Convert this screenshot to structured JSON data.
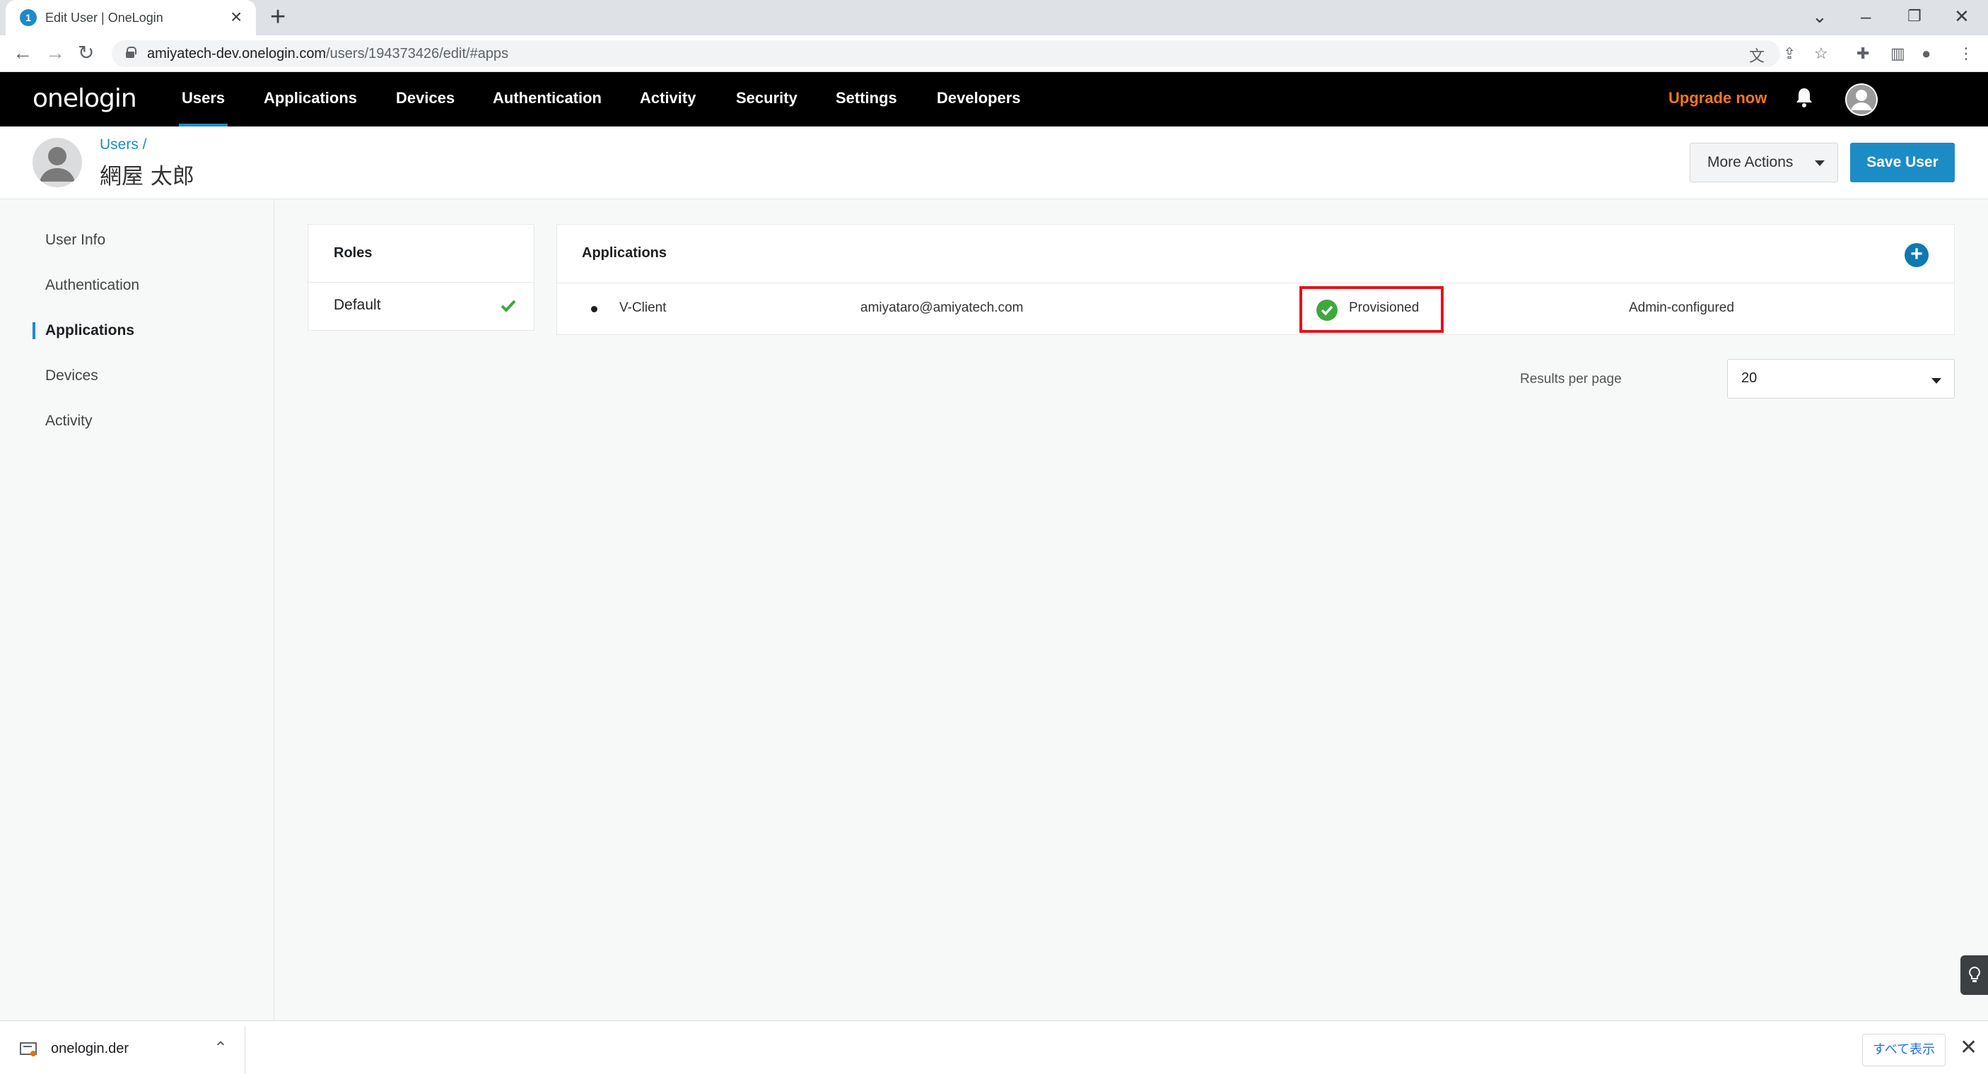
{
  "browser": {
    "tab_title": "Edit User | OneLogin",
    "favicon_glyph": "1",
    "url_host": "amiyatech-dev.onelogin.com",
    "url_path": "/users/194373426/edit/#apps"
  },
  "topnav": {
    "logo": "onelogin",
    "items": [
      "Users",
      "Applications",
      "Devices",
      "Authentication",
      "Activity",
      "Security",
      "Settings",
      "Developers"
    ],
    "active_item": "Users",
    "upgrade": "Upgrade now"
  },
  "header": {
    "breadcrumb": "Users /",
    "user_name": "網屋 太郎",
    "more_actions": "More Actions",
    "save_user": "Save User"
  },
  "sidebar": {
    "items": [
      "User Info",
      "Authentication",
      "Applications",
      "Devices",
      "Activity"
    ],
    "active_item": "Applications"
  },
  "roles": {
    "title": "Roles",
    "items": [
      {
        "name": "Default",
        "checked": true
      }
    ]
  },
  "applications": {
    "title": "Applications",
    "rows": [
      {
        "name": "V-Client",
        "login": "amiyataro@amiyatech.com",
        "status": "Provisioned",
        "config": "Admin-configured"
      }
    ],
    "results_per_page_label": "Results per page",
    "results_per_page_value": "20"
  },
  "downloads": {
    "file_name": "onelogin.der",
    "show_all": "すべて表示"
  },
  "colors": {
    "accent": "#1c8cc6",
    "upgrade": "#f2781e",
    "success": "#3ea83e",
    "highlight_box": "#e5121b"
  }
}
